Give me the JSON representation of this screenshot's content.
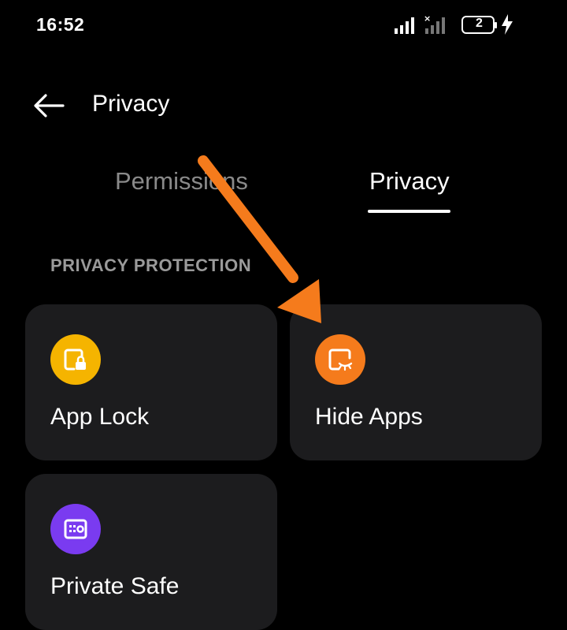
{
  "status_bar": {
    "time": "16:52",
    "battery_level": "2",
    "icons": [
      "signal-icon",
      "signal-no-sim-icon",
      "battery-icon",
      "charging-icon"
    ]
  },
  "header": {
    "title": "Privacy",
    "back_icon": "back-arrow-icon"
  },
  "tabs": [
    {
      "label": "Permissions",
      "active": false
    },
    {
      "label": "Privacy",
      "active": true
    }
  ],
  "section": {
    "title": "PRIVACY PROTECTION",
    "items": [
      {
        "label": "App Lock",
        "icon": "app-lock-icon",
        "color": "#f5b400"
      },
      {
        "label": "Hide Apps",
        "icon": "hide-apps-icon",
        "color": "#f57b1c"
      },
      {
        "label": "Private Safe",
        "icon": "private-safe-icon",
        "color": "#7a3bf0"
      }
    ]
  },
  "annotation": {
    "arrow_color": "#f57b1c"
  },
  "colors": {
    "background": "#000000",
    "card": "#1c1c1e",
    "inactive_text": "#8a8a8a"
  }
}
